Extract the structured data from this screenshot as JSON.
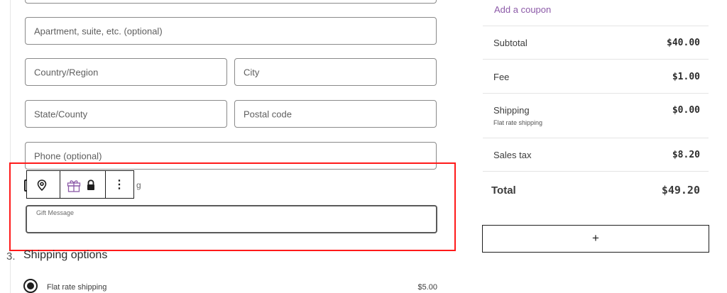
{
  "form": {
    "apartment_placeholder": "Apartment, suite, etc. (optional)",
    "country_placeholder": "Country/Region",
    "city_placeholder": "City",
    "state_placeholder": "State/County",
    "postal_placeholder": "Postal code",
    "phone_placeholder": "Phone (optional)",
    "checkbox_label_fragment": "g",
    "gift_message_label": "Gift Message"
  },
  "toolbar": {
    "icons": [
      "location-pin-icon",
      "gift-icon",
      "lock-icon",
      "more-options-icon"
    ],
    "more_glyph": "⋮"
  },
  "shipping": {
    "step_number": "3.",
    "heading": "Shipping options",
    "options": [
      {
        "label": "Flat rate shipping",
        "price": "$5.00",
        "selected": true
      }
    ]
  },
  "summary": {
    "coupon_link": "Add a coupon",
    "rows": [
      {
        "label": "Subtotal",
        "value": "$40.00"
      },
      {
        "label": "Fee",
        "value": "$1.00"
      },
      {
        "label": "Shipping",
        "sublabel": "Flat rate shipping",
        "value": "$0.00"
      },
      {
        "label": "Sales tax",
        "value": "$8.20"
      }
    ],
    "total_label": "Total",
    "total_value": "$49.20",
    "add_block_glyph": "+"
  },
  "colors": {
    "accent_purple": "#8c5aa8",
    "highlight_red": "#ff1a1a",
    "border_gray": "#8a8a8a"
  }
}
